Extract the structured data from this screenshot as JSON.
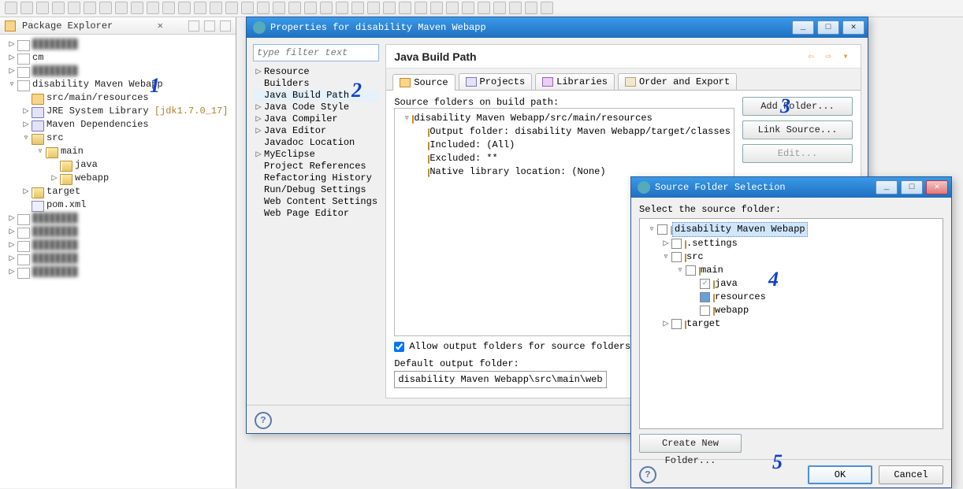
{
  "pkg_explorer": {
    "title": "Package Explorer",
    "items": [
      {
        "indent": 0,
        "exp": "▷",
        "icon": "proj",
        "label": "",
        "blur": true
      },
      {
        "indent": 0,
        "exp": "▷",
        "icon": "proj",
        "label": "cm"
      },
      {
        "indent": 0,
        "exp": "▷",
        "icon": "proj",
        "label": "",
        "blur": true
      },
      {
        "indent": 0,
        "exp": "▿",
        "icon": "proj",
        "label": "disability Maven Webapp"
      },
      {
        "indent": 1,
        "exp": "",
        "icon": "pkg",
        "label": "src/main/resources"
      },
      {
        "indent": 1,
        "exp": "▷",
        "icon": "lib",
        "label": "JRE System Library [jdk1.7.0_17]"
      },
      {
        "indent": 1,
        "exp": "▷",
        "icon": "lib",
        "label": "Maven Dependencies"
      },
      {
        "indent": 1,
        "exp": "▿",
        "icon": "folder",
        "label": "src"
      },
      {
        "indent": 2,
        "exp": "▿",
        "icon": "folder-open",
        "label": "main"
      },
      {
        "indent": 3,
        "exp": "",
        "icon": "folder-open",
        "label": "java"
      },
      {
        "indent": 3,
        "exp": "▷",
        "icon": "folder-open",
        "label": "webapp"
      },
      {
        "indent": 1,
        "exp": "▷",
        "icon": "folder-open",
        "label": "target"
      },
      {
        "indent": 1,
        "exp": "",
        "icon": "xml",
        "label": "pom.xml"
      },
      {
        "indent": 0,
        "exp": "▷",
        "icon": "proj",
        "label": "",
        "blur": true
      },
      {
        "indent": 0,
        "exp": "▷",
        "icon": "proj",
        "label": "",
        "blur": true
      },
      {
        "indent": 0,
        "exp": "▷",
        "icon": "proj",
        "label": "",
        "blur": true
      },
      {
        "indent": 0,
        "exp": "▷",
        "icon": "proj",
        "label": "",
        "blur": true
      },
      {
        "indent": 0,
        "exp": "▷",
        "icon": "proj",
        "label": "",
        "blur": true
      }
    ]
  },
  "props": {
    "title": "Properties for disability Maven Webapp",
    "filter_placeholder": "type filter text",
    "categories": [
      {
        "exp": "▷",
        "label": "Resource"
      },
      {
        "exp": "",
        "label": "Builders"
      },
      {
        "exp": "",
        "label": "Java Build Path",
        "sel": true
      },
      {
        "exp": "▷",
        "label": "Java Code Style"
      },
      {
        "exp": "▷",
        "label": "Java Compiler"
      },
      {
        "exp": "▷",
        "label": "Java Editor"
      },
      {
        "exp": "",
        "label": "Javadoc Location"
      },
      {
        "exp": "▷",
        "label": "MyEclipse"
      },
      {
        "exp": "",
        "label": "Project References"
      },
      {
        "exp": "",
        "label": "Refactoring History"
      },
      {
        "exp": "",
        "label": "Run/Debug Settings"
      },
      {
        "exp": "",
        "label": "Web Content Settings"
      },
      {
        "exp": "",
        "label": "Web Page Editor"
      }
    ],
    "heading": "Java Build Path",
    "tabs": {
      "source": "Source",
      "projects": "Projects",
      "libraries": "Libraries",
      "order": "Order and Export"
    },
    "src_label": "Source folders on build path:",
    "src_tree": [
      {
        "indent": 0,
        "exp": "▿",
        "icon": "pkg",
        "label": "disability Maven Webapp/src/main/resources"
      },
      {
        "indent": 1,
        "exp": "",
        "icon": "out",
        "label": "Output folder: disability Maven Webapp/target/classes"
      },
      {
        "indent": 1,
        "exp": "",
        "icon": "inc",
        "label": "Included: (All)"
      },
      {
        "indent": 1,
        "exp": "",
        "icon": "exc",
        "label": "Excluded: **"
      },
      {
        "indent": 1,
        "exp": "",
        "icon": "nat",
        "label": "Native library location: (None)"
      }
    ],
    "btns": {
      "add_folder": "Add Folder...",
      "link_source": "Link Source...",
      "edit": "Edit..."
    },
    "allow_output": "Allow output folders for source folders",
    "default_label": "Default output folder:",
    "default_value": "disability Maven Webapp\\src\\main\\webapp\\WEB-IN"
  },
  "sfs": {
    "title": "Source Folder Selection",
    "prompt": "Select the source folder:",
    "tree": [
      {
        "indent": 0,
        "exp": "▿",
        "chk": "",
        "label": "disability Maven Webapp",
        "hl": true
      },
      {
        "indent": 1,
        "exp": "▷",
        "chk": "",
        "label": ".settings"
      },
      {
        "indent": 1,
        "exp": "▿",
        "chk": "",
        "label": "src"
      },
      {
        "indent": 2,
        "exp": "▿",
        "chk": "",
        "label": "main"
      },
      {
        "indent": 3,
        "exp": "",
        "chk": "✓",
        "label": "java"
      },
      {
        "indent": 3,
        "exp": "",
        "chk": "half",
        "label": "resources"
      },
      {
        "indent": 3,
        "exp": "",
        "chk": "",
        "label": "webapp"
      },
      {
        "indent": 1,
        "exp": "▷",
        "chk": "",
        "label": "target"
      }
    ],
    "create_new": "Create New Folder...",
    "ok": "OK",
    "cancel": "Cancel"
  },
  "annotations": {
    "a1": "1",
    "a2": "2",
    "a3": "3",
    "a4": "4",
    "a5": "5"
  }
}
